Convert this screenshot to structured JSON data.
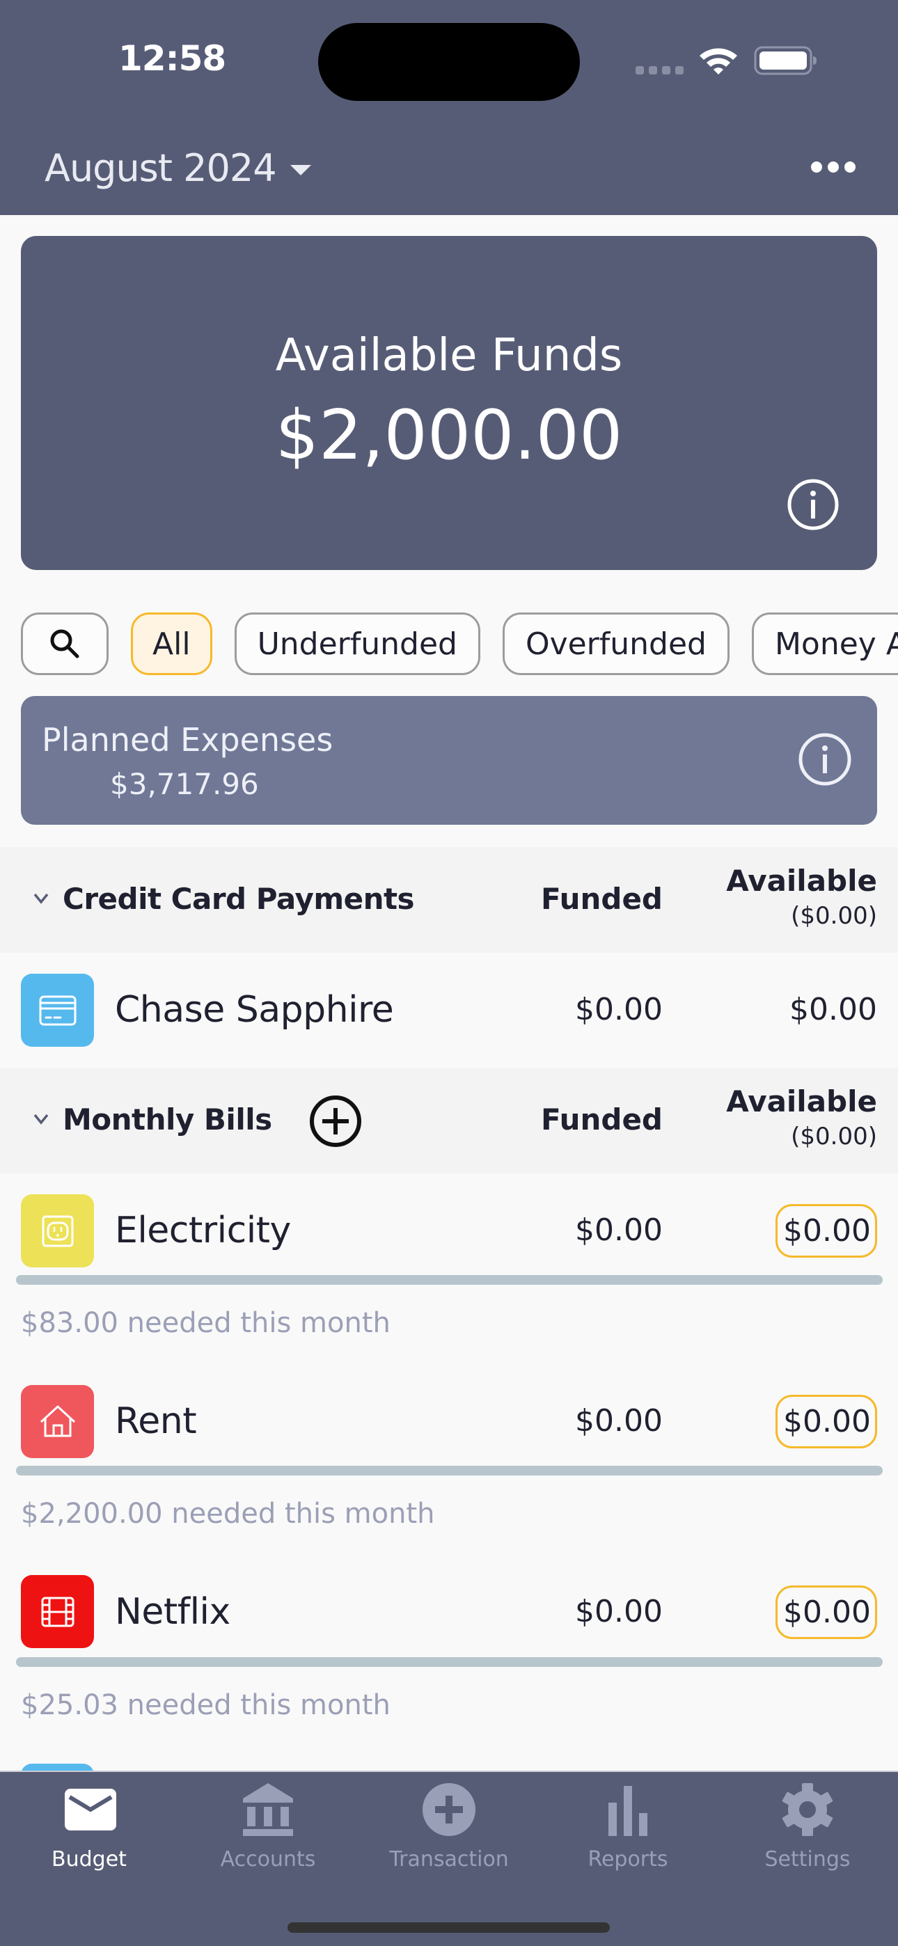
{
  "status_bar": {
    "time": "12:58",
    "signal_icon": "cellular-signal-icon",
    "wifi_icon": "wifi-icon",
    "battery_icon": "battery-icon"
  },
  "header": {
    "month": "August 2024",
    "month_icon": "caret-down-icon",
    "more_icon": "more-horizontal-icon"
  },
  "funds": {
    "title": "Available Funds",
    "amount": "$2,000.00",
    "info_icon": "info-icon"
  },
  "filters": {
    "search_icon": "search-icon",
    "chips": [
      {
        "label": "All",
        "active": true
      },
      {
        "label": "Underfunded",
        "active": false
      },
      {
        "label": "Overfunded",
        "active": false
      },
      {
        "label": "Money Avai",
        "active": false
      }
    ]
  },
  "planned": {
    "title": "Planned Expenses",
    "amount": "$3,717.96",
    "info_icon": "info-icon"
  },
  "groups": [
    {
      "title": "Credit Card Payments",
      "funded_label": "Funded",
      "available_label": "Available",
      "available_total": "($0.00)",
      "items": [
        {
          "name": "Chase Sapphire",
          "icon": "credit-card-icon",
          "color": "#56b9ee",
          "funded": "$0.00",
          "available": "$0.00"
        }
      ]
    },
    {
      "title": "Monthly Bills",
      "add_icon": "add-circle-icon",
      "funded_label": "Funded",
      "available_label": "Available",
      "available_total": "($0.00)",
      "items": [
        {
          "name": "Electricity",
          "icon": "power-outlet-icon",
          "color": "#ede157",
          "funded": "$0.00",
          "available": "$0.00",
          "progress": 0,
          "needed": "$83.00 needed this month"
        },
        {
          "name": "Rent",
          "icon": "house-icon",
          "color": "#ef575d",
          "funded": "$0.00",
          "available": "$0.00",
          "progress": 0,
          "needed": "$2,200.00 needed this month"
        },
        {
          "name": "Netflix",
          "icon": "film-icon",
          "color": "#ee1212",
          "funded": "$0.00",
          "available": "$0.00",
          "progress": 0,
          "needed": "$25.03 needed this month"
        }
      ]
    }
  ],
  "colors": {
    "header_bg": "#575c76",
    "planned_bg": "#707896",
    "accent_pill": "#f6b92a",
    "progress_track": "#b7c6cc"
  },
  "tabbar": {
    "tabs": [
      {
        "label": "Budget",
        "icon": "envelope-icon",
        "active": true
      },
      {
        "label": "Accounts",
        "icon": "bank-icon",
        "active": false
      },
      {
        "label": "Transaction",
        "icon": "add-circle-icon",
        "active": false
      },
      {
        "label": "Reports",
        "icon": "bar-chart-icon",
        "active": false
      },
      {
        "label": "Settings",
        "icon": "gear-icon",
        "active": false
      }
    ]
  }
}
